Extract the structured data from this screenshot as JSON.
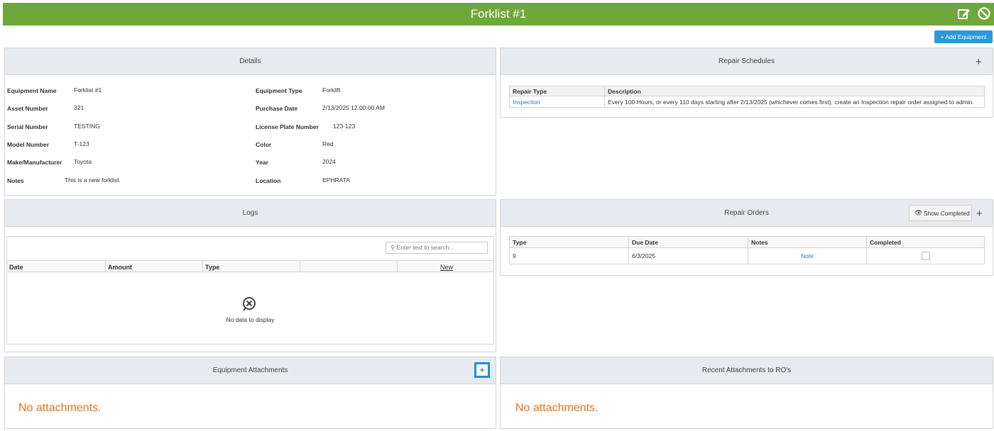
{
  "header": {
    "title": "Forklist #1",
    "edit_icon": "edit-icon",
    "cancel_icon": "cancel-circle-icon"
  },
  "toolbar": {
    "add_equipment": "+ Add Equipment"
  },
  "details": {
    "title": "Details",
    "left": [
      {
        "label": "Equipment Name",
        "value": "Forklist #1"
      },
      {
        "label": "Asset Number",
        "value": "321"
      },
      {
        "label": "Serial Number",
        "value": "TESTING"
      },
      {
        "label": "Model Number",
        "value": "T-123"
      },
      {
        "label": "Make/Manufacturer",
        "value": "Toyota"
      },
      {
        "label": "Notes",
        "value": "This is a new forklist."
      }
    ],
    "right": [
      {
        "label": "Equipment Type",
        "value": "Forklift"
      },
      {
        "label": "Purchase Date",
        "value": "2/13/2025 12:00:00 AM"
      },
      {
        "label": "License Plate Number",
        "value": "123-123"
      },
      {
        "label": "Color",
        "value": "Red"
      },
      {
        "label": "Year",
        "value": "2024"
      },
      {
        "label": "Location",
        "value": "EPHRATA"
      }
    ]
  },
  "repair_schedules": {
    "title": "Repair Schedules",
    "columns": [
      "Repair Type",
      "Description"
    ],
    "rows": [
      {
        "type": "Inspection",
        "description": "Every 100 Hours, or every 110 days starting after 2/13/2025 (whichever comes first), create an Inspection repair order assigned to admin."
      }
    ]
  },
  "logs": {
    "title": "Logs",
    "search_placeholder": "Enter text to search...",
    "columns": [
      "Date",
      "Amount",
      "Type",
      "",
      "New"
    ],
    "empty": "No data to display"
  },
  "repair_orders": {
    "title": "Repair Orders",
    "show_completed": "Show Completed",
    "columns": [
      "Type",
      "Due Date",
      "Notes",
      "Completed"
    ],
    "rows": [
      {
        "type": "9",
        "due": "6/3/2025",
        "notes": "Note",
        "completed": false
      }
    ]
  },
  "equipment_attachments": {
    "title": "Equipment Attachments",
    "empty": "No attachments."
  },
  "recent_attachments": {
    "title": "Recent Attachments to RO's",
    "empty": "No attachments."
  }
}
